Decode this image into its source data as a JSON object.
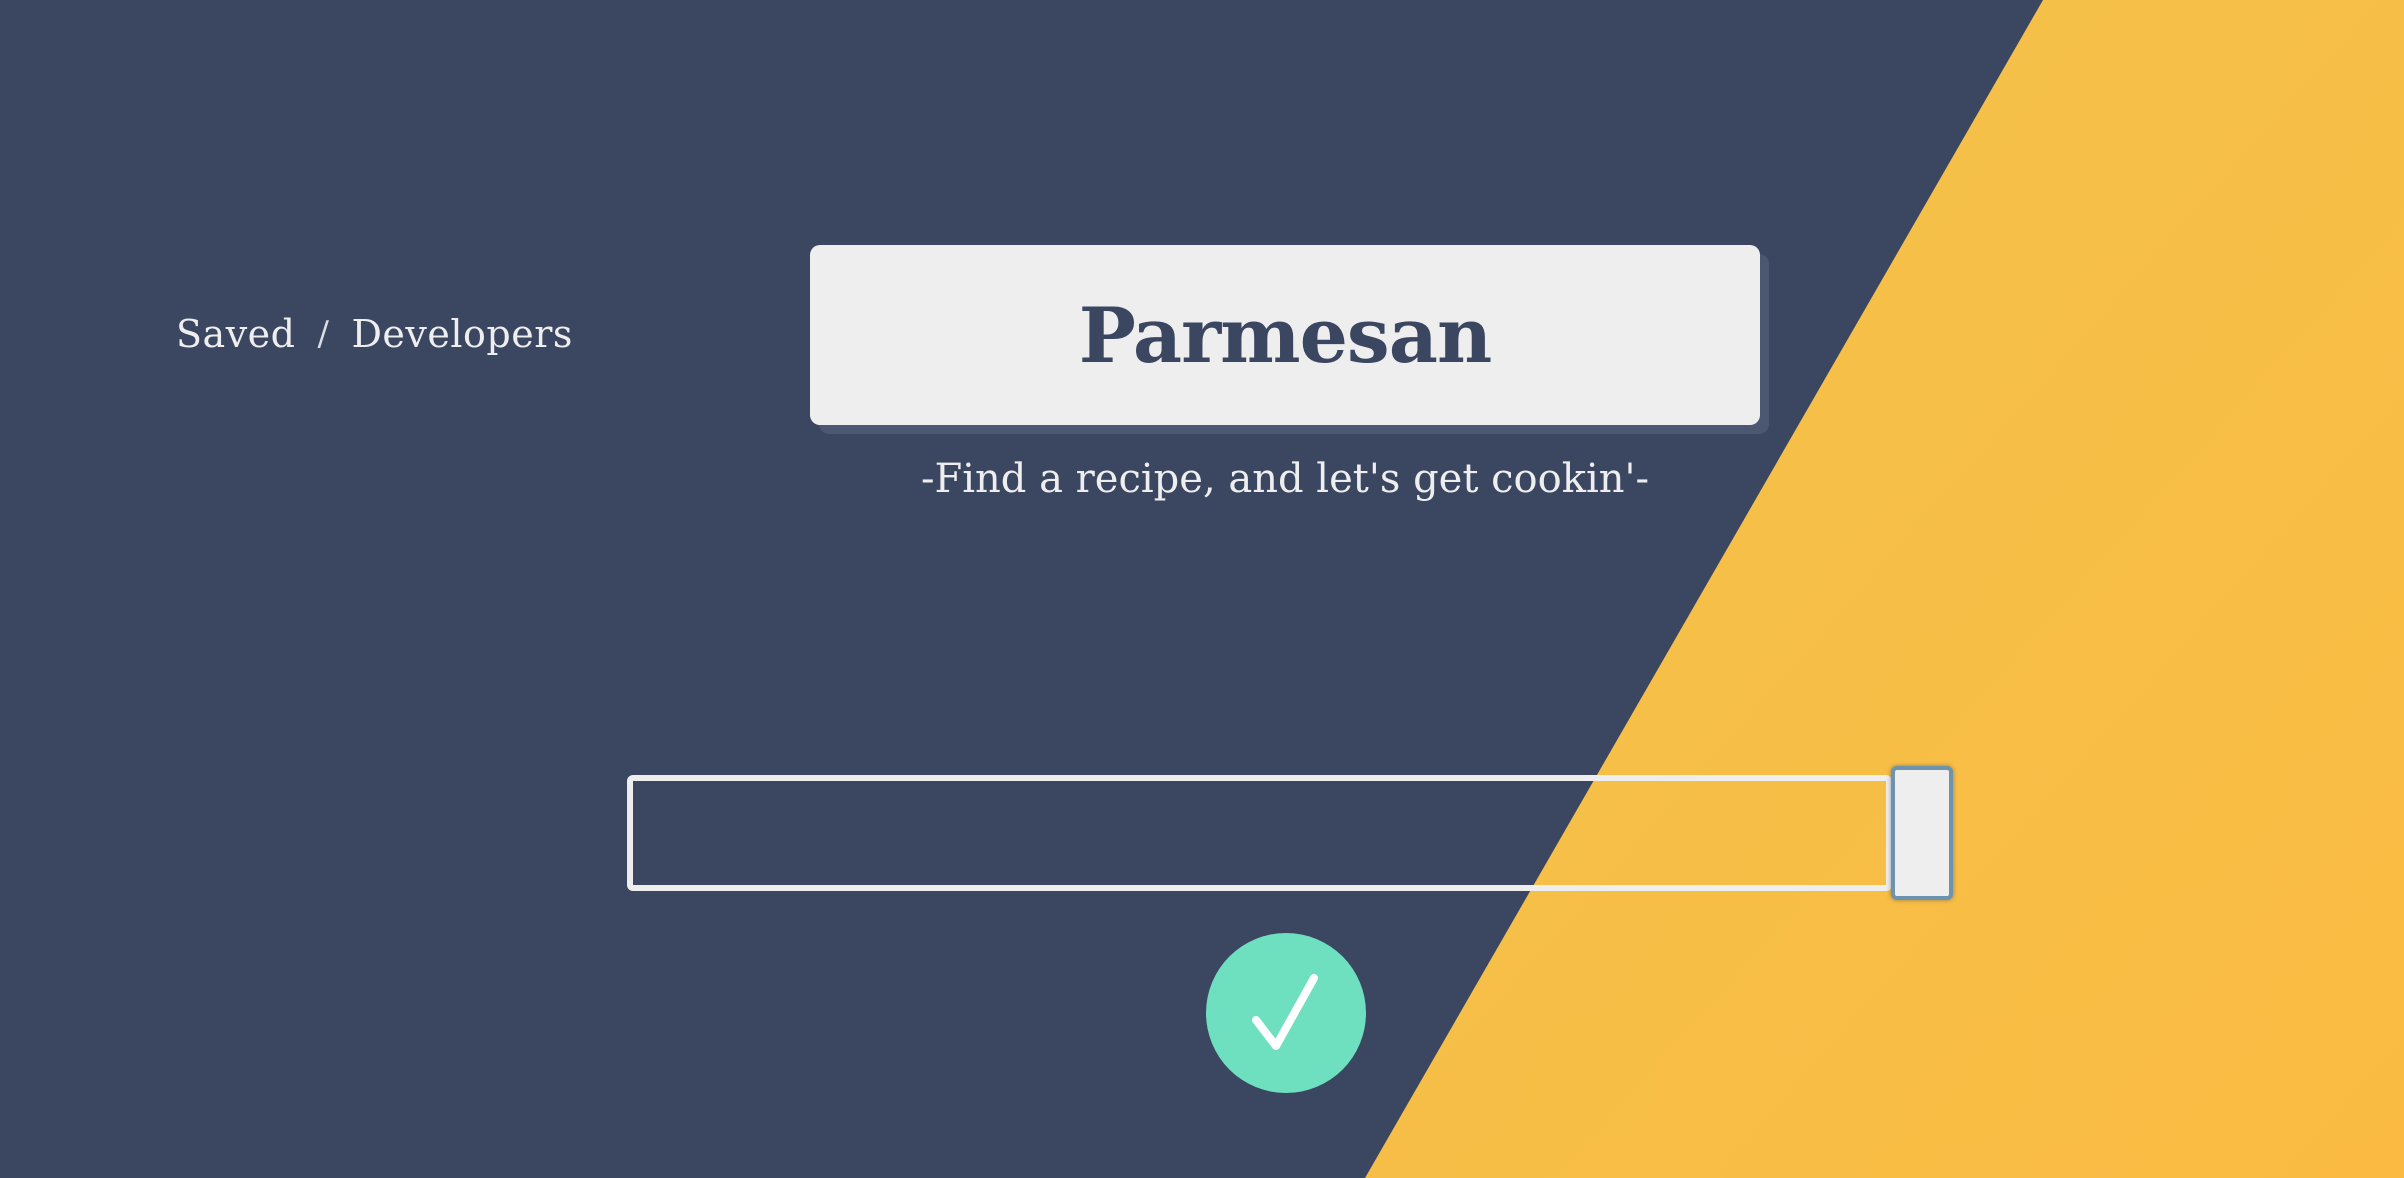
{
  "app": {
    "title": "Parmesan",
    "tagline": "-Find a recipe, and let's get cookin'-"
  },
  "nav": {
    "items": [
      {
        "label": "Saved"
      },
      {
        "label": "Developers"
      }
    ],
    "separator": "/"
  },
  "search": {
    "value": "",
    "placeholder": ""
  },
  "submit": {
    "icon": "check-icon"
  },
  "colors": {
    "background": "#3b4661",
    "accent_yellow": "#f3c24a",
    "logo_box": "#eeeeee",
    "submit_button": "#6ee0bf",
    "text_light": "#eeeeee"
  }
}
